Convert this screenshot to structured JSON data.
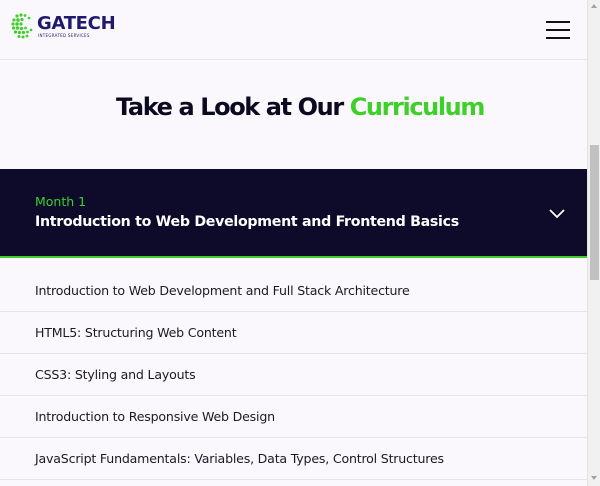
{
  "header": {
    "logo_name": "GATECH",
    "logo_sub": "INTEGRATED SERVICES",
    "menu_icon": "hamburger-menu-icon"
  },
  "section": {
    "heading_prefix": "Take a Look at Our ",
    "heading_accent": "Curriculum"
  },
  "curriculum": {
    "month_label": "Month 1",
    "month_title": "Introduction to Web Development and Frontend Basics",
    "toggle_icon": "chevron-down-icon",
    "topics": [
      "Introduction to Web Development and Full Stack Architecture",
      "HTML5: Structuring Web Content",
      "CSS3: Styling and Layouts",
      "Introduction to Responsive Web Design",
      "JavaScript Fundamentals: Variables, Data Types, Control Structures"
    ]
  },
  "colors": {
    "brand_navy": "#1f1a6e",
    "accent_green": "#3fcf2b",
    "panel_dark": "#0e0b2a"
  }
}
